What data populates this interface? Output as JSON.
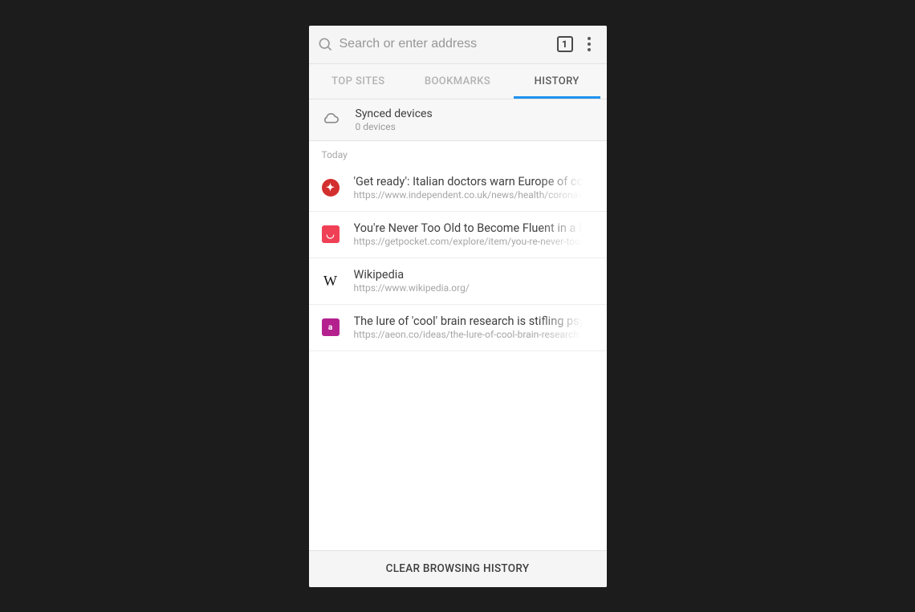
{
  "search": {
    "placeholder": "Search or enter address"
  },
  "tab_counter": "1",
  "tabs": [
    {
      "label": "TOP SITES"
    },
    {
      "label": "BOOKMARKS"
    },
    {
      "label": "HISTORY"
    }
  ],
  "synced": {
    "title": "Synced devices",
    "subtitle": "0 devices"
  },
  "section_header": "Today",
  "history": [
    {
      "title": "'Get ready': Italian doctors warn Europe of coronavirus",
      "url": "https://www.independent.co.uk/news/health/coronavirus",
      "favicon_bg": "#d32f2f",
      "favicon_glyph": "✦",
      "favicon_shape": "round"
    },
    {
      "title": "You're Never Too Old to Become Fluent in a Foreign Language",
      "url": "https://getpocket.com/explore/item/you-re-never-too-old",
      "favicon_bg": "#ef4056",
      "favicon_glyph": "◡",
      "favicon_shape": "square"
    },
    {
      "title": "Wikipedia",
      "url": "https://www.wikipedia.org/",
      "favicon_bg": "transparent",
      "favicon_glyph": "W",
      "favicon_shape": "wiki"
    },
    {
      "title": "The lure of 'cool' brain research is stifling psychotherapy",
      "url": "https://aeon.co/ideas/the-lure-of-cool-brain-research",
      "favicon_bg": "#b4218f",
      "favicon_glyph": "a",
      "favicon_shape": "square"
    }
  ],
  "footer": {
    "label": "CLEAR BROWSING HISTORY"
  }
}
